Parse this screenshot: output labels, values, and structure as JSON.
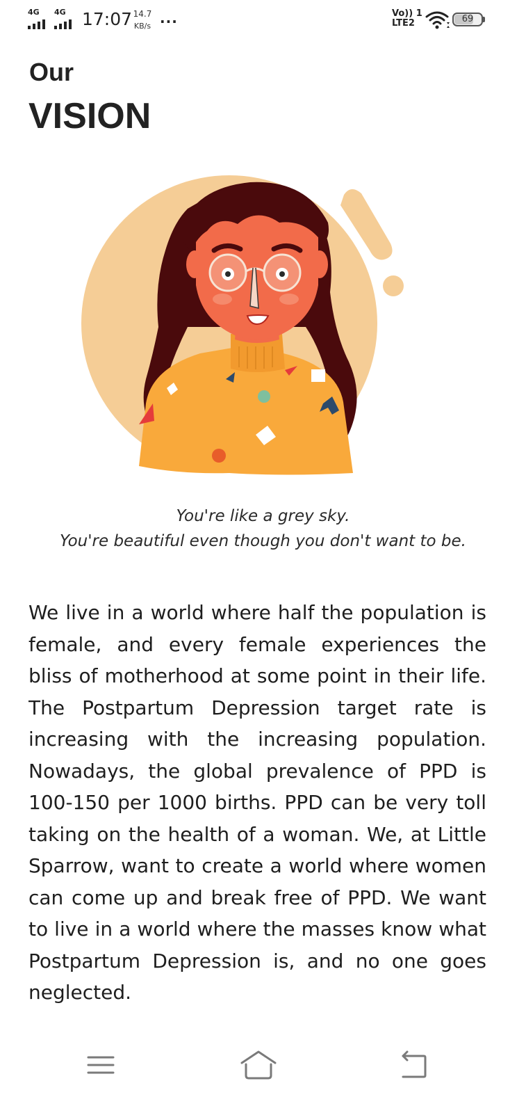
{
  "status_bar": {
    "sim1_network": "4G",
    "sim2_network": "4G",
    "time": "17:07",
    "speed_value": "14.7",
    "speed_unit": "KB/s",
    "more": "...",
    "volte_line1": "Vo)) 1",
    "volte_line2": "LTE2",
    "battery_level": "69"
  },
  "page": {
    "title_small": "Our",
    "title_big": "VISION",
    "quote_line1": "You're like a grey sky.",
    "quote_line2": "You're beautiful even though you don't want to be.",
    "body": "We live in a world where half the population is female, and every female experiences the bliss of motherhood at some point in their life. The Postpartum Depression target rate is increasing with the increasing population. Nowadays, the global prevalence of PPD is 100-150 per 1000 births. PPD can be very toll taking on the health of a woman. We, at Little Sparrow, want to create a world where women can come up and break free of PPD. We want to live in a world where the masses know what Postpartum Depression is, and no one goes neglected."
  },
  "nav_bar": {
    "menu_icon": "menu-icon",
    "home_icon": "home-icon",
    "back_icon": "back-icon"
  },
  "colors": {
    "text": "#222222",
    "circle": "#f5cd96",
    "hair": "#4a0a0c",
    "skin": "#f26b4a",
    "sweater": "#f9a93b"
  }
}
